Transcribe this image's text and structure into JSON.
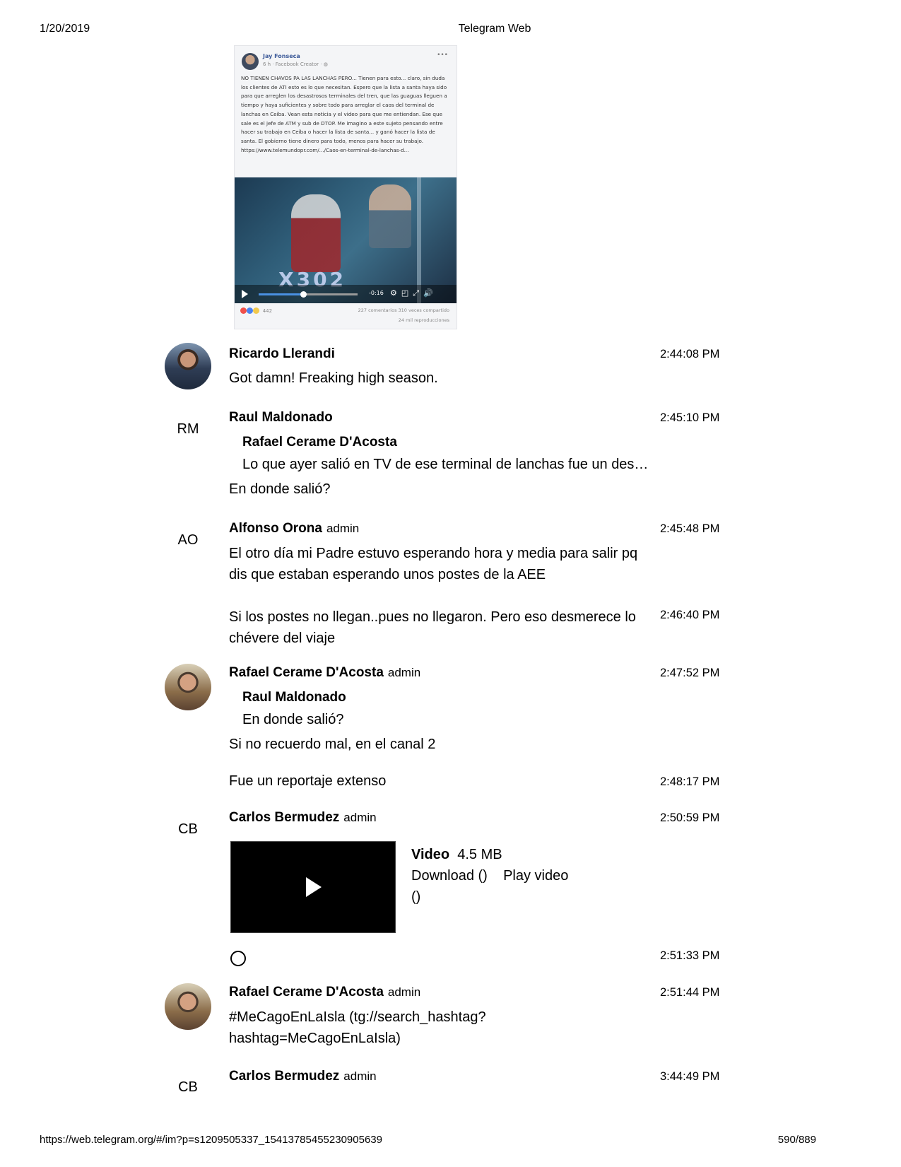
{
  "print_header": {
    "date": "1/20/2019",
    "title": "Telegram Web"
  },
  "print_footer": {
    "url": "https://web.telegram.org/#/im?p=s1209505337_15413785455230905639",
    "page": "590/889"
  },
  "facebook_post": {
    "author": "Jay Fonseca",
    "meta": "6 h · Facebook Creator · ",
    "text": "NO TIENEN CHAVOS PA LAS LANCHAS PERO... Tienen para esto... claro, sin duda los clientes de ATI esto es lo que necesitan. Espero que la lista a santa haya sido para que arreglen los desastrosos terminales del tren, que las guaguas lleguen a tiempo y haya suficientes y sobre todo para arreglar el caos del terminal de lanchas en Ceiba. Vean esta noticia y el video para que me entiendan. Ese que sale es el jefe de ATM y sub de DTOP. Me imagino a este sujeto pensando entre hacer su trabajo en Ceiba o hacer la lista de santa... y ganó hacer la lista de santa. El gobierno tiene dinero para todo, menos para hacer su trabajo. https://www.telemundopr.com/.../Caos-en-terminal-de-lanchas-d...",
    "video_overlay": "X302",
    "video_time": "-0:16",
    "reactions_count": "442",
    "stats_line1": "227 comentarios  310 veces compartido",
    "stats_line2": "24 mil reproducciones",
    "progress": 0.45
  },
  "messages": [
    {
      "name": "Ricardo Llerandi",
      "time": "2:44:08 PM",
      "text": "Got damn! Freaking high season."
    },
    {
      "name": "Raul Maldonado",
      "initials": "RM",
      "time": "2:45:10 PM",
      "reply_name": "Rafael Cerame D'Acosta",
      "reply_text": "Lo que ayer salió en TV de ese terminal de lanchas fue un des…",
      "text": "En donde salió?"
    },
    {
      "name": "Alfonso Orona",
      "badge": "admin",
      "initials": "AO",
      "time": "2:45:48 PM",
      "text_line1": "El otro día mi Padre estuvo esperando hora y media para salir pq",
      "text_line2": "dis que estaban esperando unos postes de la AEE"
    },
    {
      "time": "2:46:40 PM",
      "text_line1": "Si los postes no llegan..pues no llegaron. Pero eso desmerece lo",
      "text_line2": "chévere del viaje"
    },
    {
      "name": "Rafael Cerame D'Acosta",
      "badge": "admin",
      "time": "2:47:52 PM",
      "reply_name": "Raul Maldonado",
      "reply_text": "En donde salió?",
      "text": "Si no recuerdo mal, en el canal 2"
    },
    {
      "time": "2:48:17 PM",
      "text": "Fue un reportaje extenso"
    },
    {
      "name": "Carlos Bermudez",
      "badge": "admin",
      "initials": "CB",
      "time": "2:50:59 PM",
      "video_label": "Video",
      "video_size": "4.5 MB",
      "download": "Download ()",
      "play": "Play video",
      "paren": "()"
    },
    {
      "time": "2:51:33 PM",
      "emoji": "😂"
    },
    {
      "name": "Rafael Cerame D'Acosta",
      "badge": "admin",
      "time": "2:51:44 PM",
      "text_line1": "#MeCagoEnLaIsla (tg://search_hashtag?",
      "text_line2": "hashtag=MeCagoEnLaIsla)"
    },
    {
      "name": "Carlos Bermudez",
      "badge": "admin",
      "initials": "CB",
      "time": "3:44:49 PM"
    }
  ]
}
